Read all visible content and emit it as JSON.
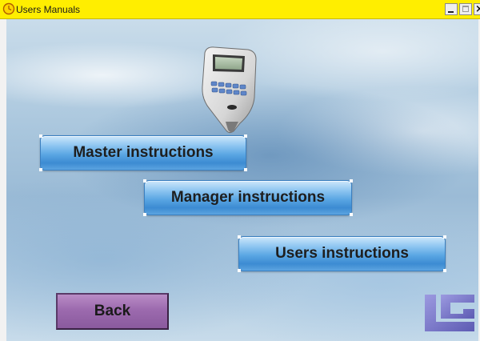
{
  "window": {
    "title": "Users Manuals",
    "controls": {
      "minimize": "minimize",
      "maximize": "maximize",
      "close": "close"
    }
  },
  "menu": {
    "master_label": "Master instructions",
    "manager_label": "Manager instructions",
    "users_label": "Users instructions",
    "back_label": "Back"
  },
  "icons": {
    "app_icon": "clock-icon",
    "device": "time-clock-terminal-icon",
    "logo": "lg-logo"
  },
  "colors": {
    "titlebar": "#ffee00",
    "menu_button": "#5aa6e3",
    "back_button": "#9c6aae",
    "logo": "#7b79c9"
  }
}
